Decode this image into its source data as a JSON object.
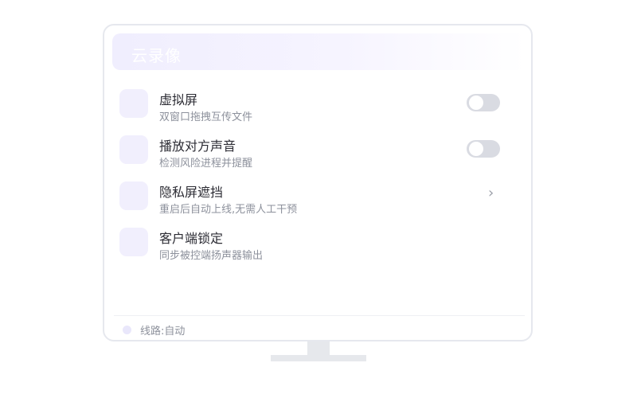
{
  "header": {
    "title": "云录像"
  },
  "menu": {
    "items": [
      {
        "title": "虚拟屏",
        "subtitle": "双窗口拖拽互传文件",
        "control": "toggle",
        "enabled": false
      },
      {
        "title": "播放对方声音",
        "subtitle": "检测风险进程并提醒",
        "control": "toggle",
        "enabled": false
      },
      {
        "title": "隐私屏遮挡",
        "subtitle": "重启后自动上线,无需人工干预",
        "control": "chevron",
        "chevron_glyph": "›"
      },
      {
        "title": "客户端锁定",
        "subtitle": "同步被控端扬声器输出",
        "control": "none"
      }
    ]
  },
  "footer": {
    "status": "线路:自动"
  },
  "colors": {
    "accent_light": "#f1effd",
    "toggle_off": "#d9dbe2",
    "border": "#e6e8ee"
  }
}
